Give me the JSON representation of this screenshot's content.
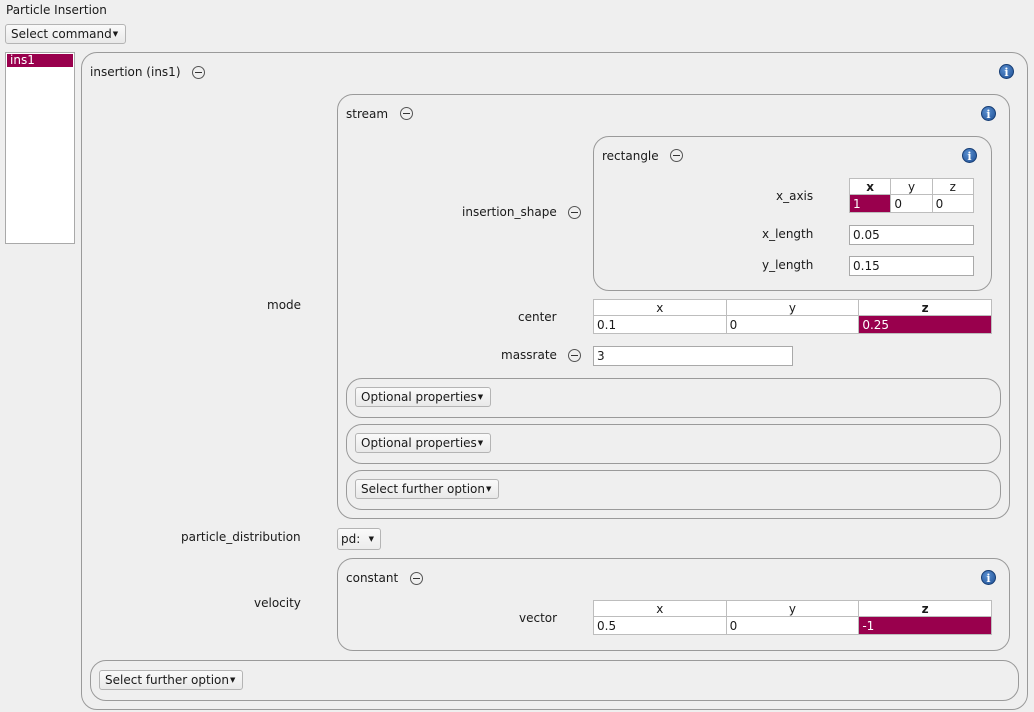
{
  "window": {
    "title": "Particle Insertion"
  },
  "toolbar": {
    "select_command": "Select command"
  },
  "list": {
    "items": [
      "ins1"
    ]
  },
  "insertion": {
    "label": "insertion (ins1)",
    "mode_label": "mode",
    "stream": {
      "label": "stream",
      "insertion_shape_label": "insertion_shape",
      "rectangle": {
        "label": "rectangle",
        "x_axis_label": "x_axis",
        "x_axis_headers": [
          "x",
          "y",
          "z"
        ],
        "x_axis_values": [
          "1",
          "0",
          "0"
        ],
        "x_length_label": "x_length",
        "x_length_value": "0.05",
        "y_length_label": "y_length",
        "y_length_value": "0.15"
      },
      "center_label": "center",
      "center_headers": [
        "x",
        "y",
        "z"
      ],
      "center_values": [
        "0.1",
        "0",
        "0.25"
      ],
      "massrate_label": "massrate",
      "massrate_value": "3",
      "optional_properties_1": "Optional properties",
      "optional_properties_2": "Optional properties",
      "select_further_option": "Select further option"
    },
    "particle_distribution_label": "particle_distribution",
    "particle_distribution_value": "pd:",
    "velocity_label": "velocity",
    "constant": {
      "label": "constant",
      "vector_label": "vector",
      "vector_headers": [
        "x",
        "y",
        "z"
      ],
      "vector_values": [
        "0.5",
        "0",
        "-1"
      ]
    },
    "select_further_option": "Select further option"
  },
  "colors": {
    "selection": "#99004d",
    "info": "#1e4f94"
  }
}
